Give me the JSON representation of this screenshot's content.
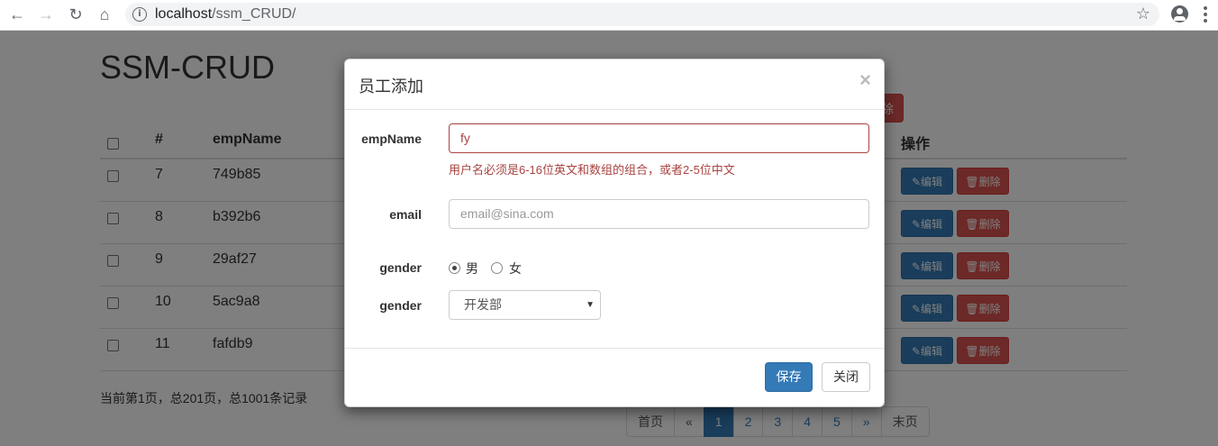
{
  "browser": {
    "url_host": "localhost",
    "url_path": "/ssm_CRUD/",
    "back_icon": "←",
    "forward_icon": "→",
    "reload_icon": "↻",
    "home_icon": "⌂",
    "info_icon": "i",
    "star_icon": "☆"
  },
  "page": {
    "title": "SSM-CRUD",
    "top_delete_label": "除",
    "columns": [
      "#",
      "empName",
      "操作"
    ],
    "rows": [
      {
        "id": "7",
        "name": "749b85"
      },
      {
        "id": "8",
        "name": "b392b6"
      },
      {
        "id": "9",
        "name": "29af27"
      },
      {
        "id": "10",
        "name": "5ac9a8"
      },
      {
        "id": "11",
        "name": "fafdb9"
      }
    ],
    "edit_label": "✎编辑",
    "delete_label": "🗑删除",
    "page_info": "当前第1页，总201页，总1001条记录",
    "pagination": [
      "首页",
      "«",
      "1",
      "2",
      "3",
      "4",
      "5",
      "»",
      "末页"
    ],
    "active_page": "1"
  },
  "modal": {
    "title": "员工添加",
    "close_symbol": "×",
    "empname_label": "empName",
    "empname_value": "fy",
    "empname_error": "用户名必须是6-16位英文和数组的组合，或者2-5位中文",
    "email_label": "email",
    "email_placeholder": "email@sina.com",
    "gender_label": "gender",
    "gender_options": [
      "男",
      "女"
    ],
    "gender_selected": "男",
    "dept_label": "gender",
    "dept_value": "开发部",
    "dept_caret": "▼",
    "save_label": "保存",
    "close_label": "关闭"
  }
}
